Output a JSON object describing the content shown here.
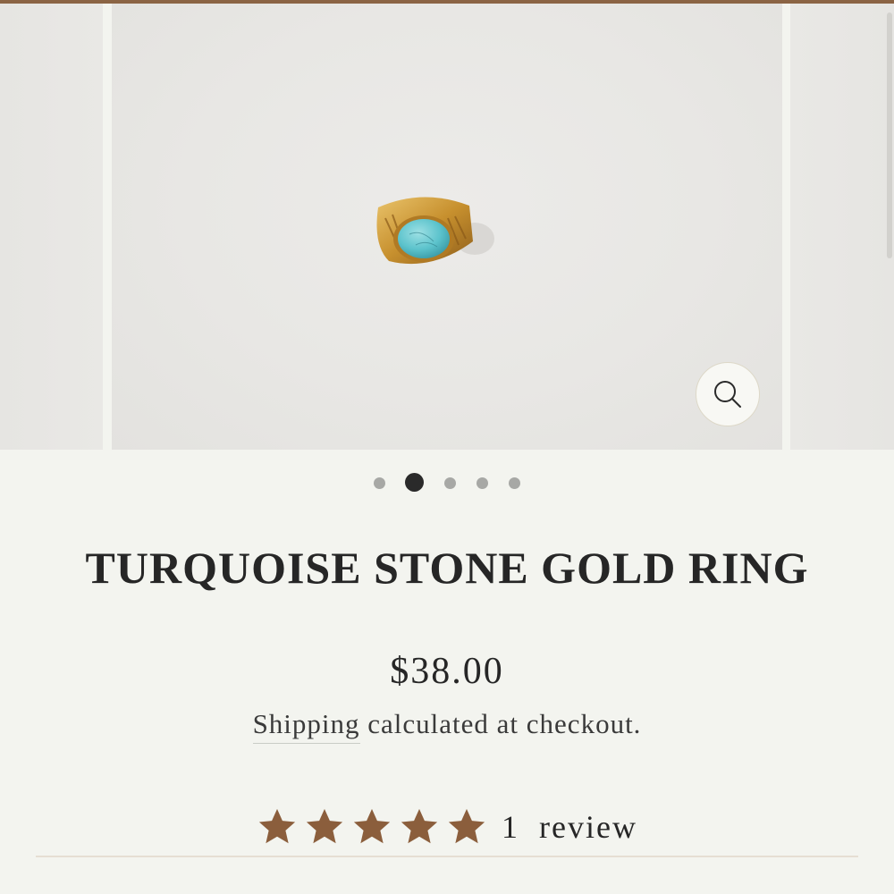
{
  "product": {
    "title": "TURQUOISE STONE GOLD RING",
    "price": "$38.00",
    "shipping_link": "Shipping",
    "shipping_rest": " calculated at checkout."
  },
  "gallery": {
    "slide_count": 5,
    "active_slide": 2,
    "zoom_icon": "magnifier-icon"
  },
  "reviews": {
    "rating": 5,
    "max_rating": 5,
    "count_label": "1  review"
  },
  "colors": {
    "background": "#f3f4ef",
    "star": "#8b5e3c",
    "accent_bar": "#8b6444",
    "active_dot": "#2a2a2a",
    "inactive_dot": "#a7a8a5"
  }
}
